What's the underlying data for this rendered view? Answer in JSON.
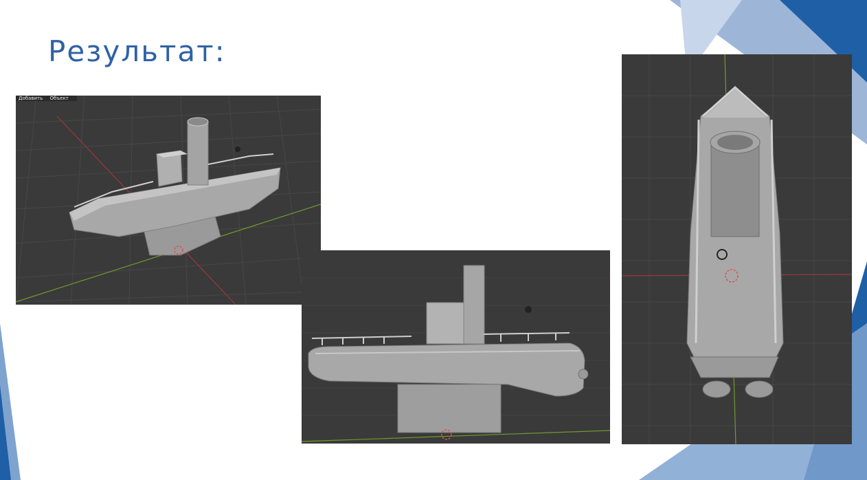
{
  "slide": {
    "title": "Результат:"
  },
  "screenshots": [
    {
      "menu": [
        "Добавить",
        "Объект"
      ]
    },
    {
      "menu": []
    },
    {
      "menu": []
    }
  ],
  "colors": {
    "title": "#2f62a5",
    "viewport_bg": "#3a3a3a",
    "grid_line": "#474747",
    "axis_x": "#a0353f",
    "axis_y": "#6e9a2f",
    "model": "#a8a8a8",
    "accent_dark": "#1f5fa6",
    "accent_light": "#7fa3cf"
  }
}
